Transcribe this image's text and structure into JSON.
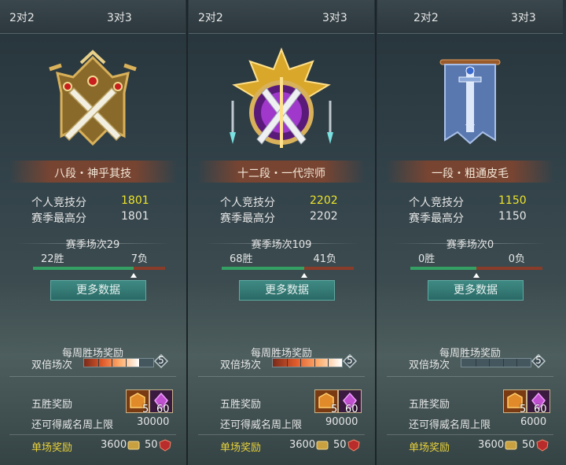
{
  "panels": [
    {
      "tabs": [
        "2对2",
        "3对3"
      ],
      "emblem": "bronze-swords-emblem-icon",
      "rank_name": "八段・神乎其技",
      "score_label": "个人竞技分",
      "score": "1801",
      "best_label": "赛季最高分",
      "best": "1801",
      "season": "赛季场次29",
      "wins": "22胜",
      "losses": "7负",
      "win_ratio": 0.759,
      "more_button": "更多数据",
      "weekly_title": "每周胜场奖励",
      "double_label": "双倍场次",
      "double_max": "5",
      "double_progress": 0.8,
      "five_win_label": "五胜奖励",
      "item1_count": "5",
      "item2_count": "60",
      "cap_label": "还可得威名周上限",
      "cap_value": "30000",
      "single_label": "单场奖励",
      "single_coin": "3600",
      "single_honor": "50"
    },
    {
      "tabs": [
        "2对2",
        "3对3"
      ],
      "emblem": "purple-gold-swords-emblem-icon",
      "rank_name": "十二段・一代宗师",
      "score_label": "个人竞技分",
      "score": "2202",
      "best_label": "赛季最高分",
      "best": "2202",
      "season": "赛季场次109",
      "wins": "68胜",
      "losses": "41负",
      "win_ratio": 0.624,
      "more_button": "更多数据",
      "weekly_title": "每周胜场奖励",
      "double_label": "双倍场次",
      "double_max": "5",
      "double_progress": 1.0,
      "five_win_label": "五胜奖励",
      "item1_count": "5",
      "item2_count": "60",
      "cap_label": "还可得威名周上限",
      "cap_value": "90000",
      "single_label": "单场奖励",
      "single_coin": "3600",
      "single_honor": "50"
    },
    {
      "tabs": [
        "2对2",
        "3对3"
      ],
      "emblem": "blue-banner-sword-icon",
      "rank_name": "一段・粗通皮毛",
      "score_label": "个人竞技分",
      "score": "1150",
      "best_label": "赛季最高分",
      "best": "1150",
      "season": "赛季场次0",
      "wins": "0胜",
      "losses": "0负",
      "win_ratio": 0.5,
      "more_button": "更多数据",
      "weekly_title": "每周胜场奖励",
      "double_label": "双倍场次",
      "double_max": "5",
      "double_progress": 0.0,
      "five_win_label": "五胜奖励",
      "item1_count": "5",
      "item2_count": "60",
      "cap_label": "还可得威名周上限",
      "cap_value": "6000",
      "single_label": "单场奖励",
      "single_coin": "3600",
      "single_honor": "50"
    }
  ],
  "colors": {
    "highlight_score": "#ece32a",
    "single_reward_label": "#e8d23a",
    "win_bar": "#35a063",
    "loss_bar": "#8a3c2a",
    "button": "#2f7570"
  }
}
